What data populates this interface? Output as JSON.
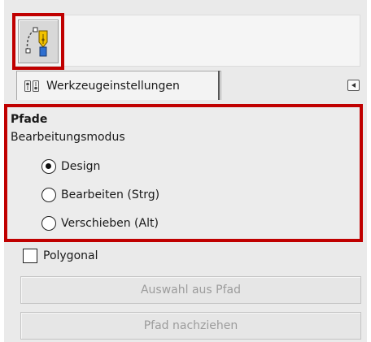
{
  "toolbox": {
    "active_tool_icon": "path-tool-icon"
  },
  "tab": {
    "icon": "tool-options-icon",
    "label": "Werkzeugeinstellungen",
    "menu_icon": "tab-menu-arrow-icon"
  },
  "options": {
    "title": "Pfade",
    "mode_label": "Bearbeitungsmodus",
    "modes": [
      {
        "label": "Design",
        "checked": true
      },
      {
        "label": "Bearbeiten (Strg)",
        "checked": false
      },
      {
        "label": "Verschieben (Alt)",
        "checked": false
      }
    ]
  },
  "polygonal": {
    "label": "Polygonal",
    "checked": false
  },
  "buttons": {
    "selection_from_path": "Auswahl aus Pfad",
    "stroke_path": "Pfad nachziehen"
  },
  "colors": {
    "highlight": "#c00000",
    "disabled_text": "#9c9c9c"
  }
}
